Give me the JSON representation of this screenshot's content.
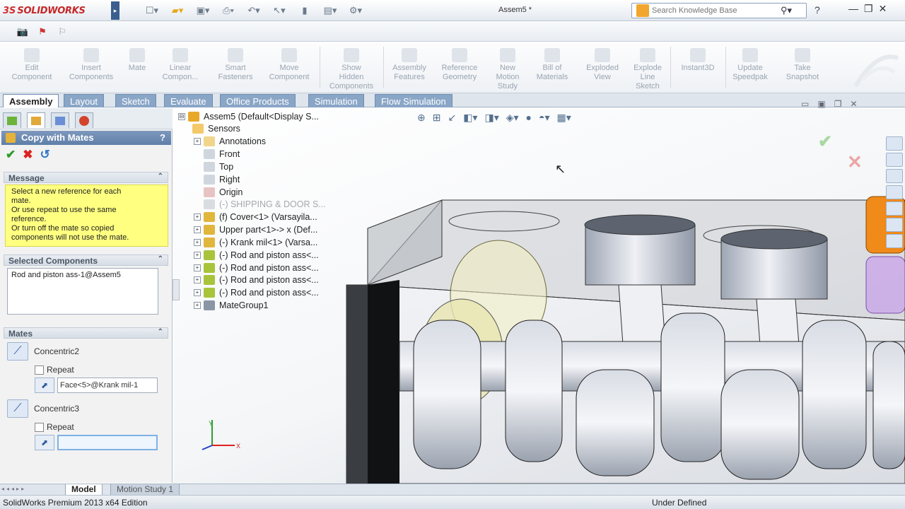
{
  "titlebar": {
    "brand": "SOLIDWORKS",
    "ds_mark": "3S",
    "document_title": "Assem5 *",
    "search_placeholder": "Search Knowledge Base",
    "win_minimize": "—",
    "win_restore": "❐",
    "win_close": "✕",
    "help_glyph": "?"
  },
  "command_manager": {
    "buttons": [
      {
        "label": "Edit\nComponent"
      },
      {
        "label": "Insert\nComponents"
      },
      {
        "label": "Mate"
      },
      {
        "label": "Linear\nCompon..."
      },
      {
        "label": "Smart\nFasteners"
      },
      {
        "label": "Move\nComponent"
      },
      {
        "label": "Show\nHidden\nComponents"
      },
      {
        "label": "Assembly\nFeatures"
      },
      {
        "label": "Reference\nGeometry"
      },
      {
        "label": "New\nMotion\nStudy"
      },
      {
        "label": "Bill of\nMaterials"
      },
      {
        "label": "Exploded\nView"
      },
      {
        "label": "Explode\nLine\nSketch"
      },
      {
        "label": "Instant3D"
      },
      {
        "label": "Update\nSpeedpak"
      },
      {
        "label": "Take\nSnapshot"
      }
    ]
  },
  "tabs": [
    "Assembly",
    "Layout",
    "Sketch",
    "Evaluate",
    "Office Products",
    "Simulation",
    "Flow Simulation"
  ],
  "property_manager": {
    "title": "Copy with Mates",
    "help": "?",
    "ok": "✔",
    "cancel": "✖",
    "undo": "↺",
    "message_header": "Message",
    "message": [
      "Select a new reference for each",
      "mate.",
      "Or use repeat to use the same",
      "reference.",
      "Or turn off the mate so copied",
      "components will not use the mate."
    ],
    "selected_header": "Selected Components",
    "selected_items": [
      "Rod and piston ass-1@Assem5"
    ],
    "mates_header": "Mates",
    "mates": [
      {
        "name": "Concentric2",
        "repeat_label": "Repeat",
        "face_value": "Face<5>@Krank mil-1"
      },
      {
        "name": "Concentric3",
        "repeat_label": "Repeat",
        "face_value": ""
      }
    ],
    "collapse_glyph": "⌃"
  },
  "feature_tree": [
    {
      "label": "Assem5  (Default<Display S...",
      "expander": "⊟",
      "icon_color": "#e8a92a"
    },
    {
      "label": "Sensors",
      "expander": "",
      "icon_color": "#f3c96a"
    },
    {
      "label": "Annotations",
      "expander": "+",
      "icon_color": "#f1d58b"
    },
    {
      "label": "Front",
      "expander": "",
      "icon_color": "#cfd6de"
    },
    {
      "label": "Top",
      "expander": "",
      "icon_color": "#cfd6de"
    },
    {
      "label": "Right",
      "expander": "",
      "icon_color": "#cfd6de"
    },
    {
      "label": "Origin",
      "expander": "",
      "icon_color": "#d77"
    },
    {
      "label": "(-) SHIPPING & DOOR S...",
      "expander": "",
      "icon_color": "#d9dde2",
      "grey": true
    },
    {
      "label": "(f) Cover<1> (Varsayila...",
      "expander": "+",
      "icon_color": "#e0b63d"
    },
    {
      "label": "Upper part<1>-> x (Def...",
      "expander": "+",
      "icon_color": "#e0b63d"
    },
    {
      "label": "(-) Krank mil<1> (Varsa...",
      "expander": "+",
      "icon_color": "#e0b63d"
    },
    {
      "label": "(-) Rod and piston ass<...",
      "expander": "+",
      "icon_color": "#a8c43b"
    },
    {
      "label": "(-) Rod and piston ass<...",
      "expander": "+",
      "icon_color": "#a8c43b"
    },
    {
      "label": "(-) Rod and piston ass<...",
      "expander": "+",
      "icon_color": "#a8c43b"
    },
    {
      "label": "(-) Rod and piston ass<...",
      "expander": "+",
      "icon_color": "#a8c43b"
    },
    {
      "label": "MateGroup1",
      "expander": "+",
      "icon_color": "#8a96a4"
    }
  ],
  "triad": {
    "x_label": "X",
    "y_label": "Y"
  },
  "bottom_tabs": [
    "Model",
    "Motion Study 1"
  ],
  "status": {
    "edition": "SolidWorks Premium 2013 x64 Edition",
    "state": "Under Defined"
  }
}
